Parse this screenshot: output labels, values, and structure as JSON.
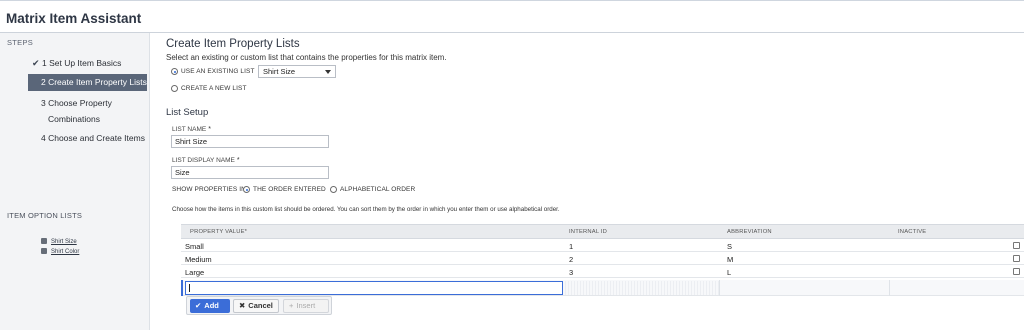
{
  "app": {
    "title": "Matrix Item Assistant"
  },
  "sidebar": {
    "steps_heading": "STEPS",
    "steps": [
      {
        "label": "1 Set Up Item Basics",
        "done": true
      },
      {
        "label": "2 Create Item Property Lists",
        "active": true
      },
      {
        "label_line1": "3 Choose Property",
        "label_line2": "Combinations"
      },
      {
        "label": "4 Choose and Create Items"
      }
    ],
    "option_lists_heading": "ITEM OPTION LISTS",
    "option_lists": [
      "Shirt Size",
      "Shirt Color"
    ]
  },
  "main": {
    "title": "Create Item Property Lists",
    "subtitle": "Select an existing or custom list that contains the properties for this matrix item.",
    "use_existing_label": "USE AN EXISTING LIST",
    "existing_list_value": "Shirt Size",
    "create_new_label": "CREATE A NEW LIST",
    "list_setup_heading": "List Setup",
    "list_name_label": "LIST NAME",
    "list_name_value": "Shirt Size",
    "list_display_name_label": "LIST DISPLAY NAME",
    "list_display_name_value": "Size",
    "required_mark": "*",
    "show_properties_label": "SHOW PROPERTIES IN",
    "order_entered_label": "THE ORDER ENTERED",
    "alphabetical_label": "ALPHABETICAL ORDER",
    "help_text": "Choose how the items in this custom list should be ordered. You can sort them by the order in which you enter them or use alphabetical order."
  },
  "grid": {
    "headers": {
      "property_value": "PROPERTY VALUE",
      "internal_id": "INTERNAL ID",
      "abbreviation": "ABBREVIATION",
      "inactive": "INACTIVE"
    },
    "rows": [
      {
        "value": "Small",
        "id": "1",
        "abbr": "S"
      },
      {
        "value": "Medium",
        "id": "2",
        "abbr": "M"
      },
      {
        "value": "Large",
        "id": "3",
        "abbr": "L"
      }
    ]
  },
  "buttons": {
    "add": "Add",
    "cancel": "Cancel",
    "insert": "Insert"
  },
  "colors": {
    "accent": "#3b6dd8",
    "active_step": "#5a6679"
  }
}
